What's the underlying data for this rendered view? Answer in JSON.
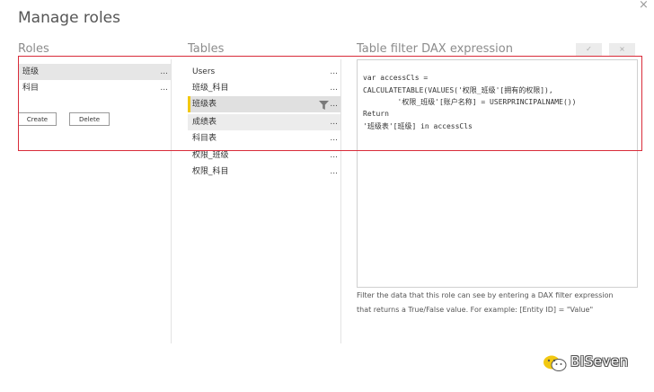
{
  "dialog": {
    "title": "Manage roles",
    "close_glyph": "×"
  },
  "roles": {
    "header": "Roles",
    "items": [
      {
        "name": "班级",
        "menu": "..."
      },
      {
        "name": "科目",
        "menu": "..."
      }
    ],
    "create_label": "Create",
    "delete_label": "Delete"
  },
  "tables": {
    "header": "Tables",
    "items": [
      {
        "name": "Users",
        "menu": "..."
      },
      {
        "name": "班级_科目",
        "menu": "..."
      },
      {
        "name": "班级表",
        "menu": "..."
      },
      {
        "name": "成绩表",
        "menu": "..."
      },
      {
        "name": "科目表",
        "menu": "..."
      },
      {
        "name": "权限_班级",
        "menu": "..."
      },
      {
        "name": "权限_科目",
        "menu": "..."
      }
    ]
  },
  "dax": {
    "header": "Table filter DAX expression",
    "check_glyph": "✓",
    "cancel_glyph": "×",
    "lines": [
      "var accessCls =",
      "CALCULATETABLE(VALUES('权限_班级'[拥有的权限]),",
      "        '权限_班级'[账户名称] = USERPRINCIPALNAME())",
      "Return",
      "'班级表'[班级] in accessCls"
    ],
    "help_line1": "Filter the data that this role can see by entering a DAX filter expression",
    "help_line2": "that returns a True/False value. For example: [Entity ID] = \"Value\""
  },
  "watermark": {
    "text": "BISeven"
  },
  "colors": {
    "highlight_box": "#d92c3a",
    "selected_table_accent": "#f2c811"
  }
}
